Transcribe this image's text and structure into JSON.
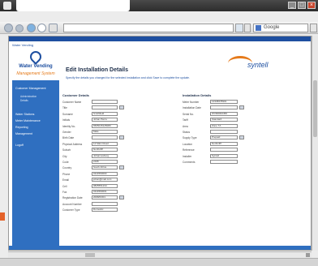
{
  "browser": {
    "address": "",
    "search_text": "Google"
  },
  "app": {
    "tab_label": "Water Vending",
    "logo_line1": "Water Vending",
    "logo_line2": "Management System",
    "page_title": "Edit Installation Details",
    "page_subtitle": "Specify the details you changed for the selected installation and click Save to complete the update.",
    "brand": "syntell",
    "sidebar": {
      "items": [
        {
          "label": "Customer Management"
        },
        {
          "label": "Water Stations"
        },
        {
          "label": "Meter Maintenance"
        },
        {
          "label": "Reporting"
        },
        {
          "label": "Management"
        },
        {
          "label": "Logoff"
        }
      ],
      "sub_items": [
        {
          "label": "Administration"
        },
        {
          "label": "Details"
        }
      ]
    },
    "left_section_title": "Customer Details",
    "right_section_title": "Installation Details",
    "left_fields": [
      {
        "label": "Customer Name",
        "value": ""
      },
      {
        "label": "Title",
        "value": ""
      },
      {
        "label": "Surname",
        "value": "Smithfield"
      },
      {
        "label": "Initials",
        "value": "Johan Pierre"
      },
      {
        "label": "Identity No.",
        "value": "6505015125083"
      },
      {
        "label": "Gender",
        "value": "Male"
      },
      {
        "label": "Birth Date",
        "value": ""
      },
      {
        "label": "Physical Address",
        "value": "12 Main Road"
      },
      {
        "label": "Suburb",
        "value": "Northcliff"
      },
      {
        "label": "City",
        "value": "Johannesburg"
      },
      {
        "label": "Code",
        "value": "2195"
      },
      {
        "label": "Country",
        "value": "South Africa"
      },
      {
        "label": "Phone",
        "value": "0114560000"
      },
      {
        "label": "Email",
        "value": "johan@mail.com"
      },
      {
        "label": "Cell",
        "value": "0825551234"
      },
      {
        "label": "Fax",
        "value": "0114560001"
      },
      {
        "label": "Registration Date",
        "value": "2008/03/01"
      },
      {
        "label": "Account Number",
        "value": ""
      },
      {
        "label": "Customer Type",
        "value": "Domestic"
      }
    ],
    "right_fields": [
      {
        "label": "Meter Number",
        "value": "12345678901"
      },
      {
        "label": "Installation Date",
        "value": ""
      },
      {
        "label": "Serial No.",
        "value": "WVM0002456"
      },
      {
        "label": "Tariff",
        "value": "Standard"
      },
      {
        "label": "Area",
        "value": "Zone 7A"
      },
      {
        "label": "Status",
        "value": ""
      },
      {
        "label": "Supply Type",
        "value": "Prepaid"
      },
      {
        "label": "Location",
        "value": "Northcliff"
      },
      {
        "label": "Reference",
        "value": ""
      },
      {
        "label": "Installer",
        "value": "Syntell"
      },
      {
        "label": "Comments",
        "value": ""
      }
    ]
  }
}
